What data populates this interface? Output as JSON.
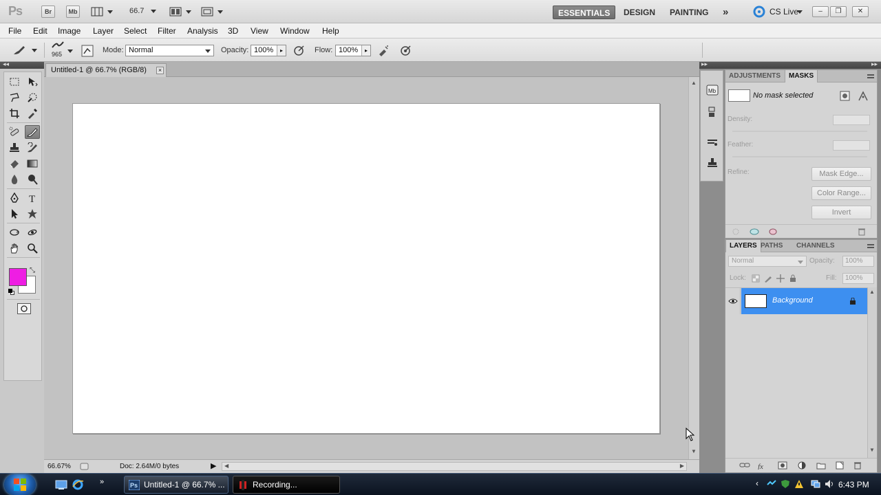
{
  "app": {
    "logo": "Ps",
    "bridge_label": "Br",
    "minibridge_label": "Mb",
    "zoom_value": "66.7",
    "workspaces": [
      "ESSENTIALS",
      "DESIGN",
      "PAINTING"
    ],
    "more_workspaces": "»",
    "cs_live": "CS Live",
    "window_buttons": {
      "minimize": "–",
      "restore": "❐",
      "close": "✕"
    }
  },
  "menu": [
    "File",
    "Edit",
    "Image",
    "Layer",
    "Select",
    "Filter",
    "Analysis",
    "3D",
    "View",
    "Window",
    "Help"
  ],
  "options": {
    "brush_size": "965",
    "mode_label": "Mode:",
    "mode_value": "Normal",
    "opacity_label": "Opacity:",
    "opacity_value": "100%",
    "flow_label": "Flow:",
    "flow_value": "100%"
  },
  "colors": {
    "foreground": "#ee1ee3",
    "background": "#ffffff",
    "selected_layer": "#3d8ff0",
    "active_workspace": "#767676"
  },
  "document": {
    "tab_title": "Untitled-1 @ 66.7% (RGB/8)",
    "tab_close": "×",
    "zoom_status": "66.67%",
    "doc_info": "Doc: 2.64M/0 bytes"
  },
  "masks_panel": {
    "tabs": [
      "ADJUSTMENTS",
      "MASKS"
    ],
    "active_tab": "MASKS",
    "no_mask": "No mask selected",
    "density_label": "Density:",
    "feather_label": "Feather:",
    "refine_label": "Refine:",
    "buttons": [
      "Mask Edge...",
      "Color Range...",
      "Invert"
    ]
  },
  "layers_panel": {
    "tabs": [
      "LAYERS",
      "PATHS",
      "CHANNELS"
    ],
    "active_tab": "LAYERS",
    "blend_mode": "Normal",
    "opacity_label": "Opacity:",
    "opacity_value": "100%",
    "lock_label": "Lock:",
    "fill_label": "Fill:",
    "fill_value": "100%",
    "layers": [
      {
        "name": "Background",
        "visible": true,
        "locked": true
      }
    ]
  },
  "taskbar": {
    "items": [
      "Untitled-1 @ 66.7% ...",
      "Recording..."
    ],
    "clock": "6:43 PM"
  }
}
